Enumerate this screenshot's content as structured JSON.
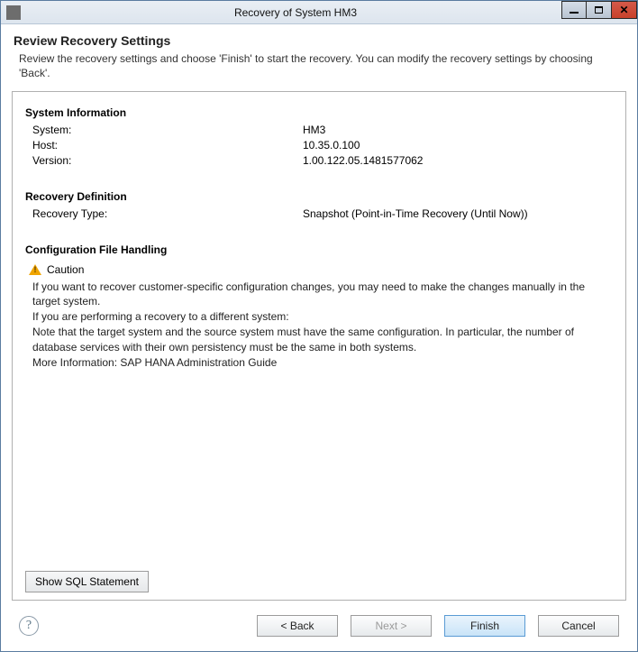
{
  "window": {
    "title": "Recovery of System HM3"
  },
  "header": {
    "title": "Review Recovery Settings",
    "description": "Review the recovery settings and choose 'Finish' to start the recovery. You can modify the recovery settings by choosing 'Back'."
  },
  "sections": {
    "system_info": {
      "title": "System Information",
      "rows": [
        {
          "label": "System:",
          "value": "HM3"
        },
        {
          "label": "Host:",
          "value": "10.35.0.100"
        },
        {
          "label": "Version:",
          "value": "1.00.122.05.1481577062"
        }
      ]
    },
    "recovery_def": {
      "title": "Recovery Definition",
      "rows": [
        {
          "label": "Recovery Type:",
          "value": "Snapshot (Point-in-Time Recovery (Until Now))"
        }
      ]
    },
    "config_handling": {
      "title": "Configuration File Handling",
      "caution_label": "Caution",
      "body_line1": "If you want to recover customer-specific configuration changes, you may need to make the changes manually in the target system.",
      "body_line2": "If you are performing a recovery to a different system:",
      "body_line3": "Note that the target system and the source system must have the same configuration. In particular, the number of database services with their own persistency must be the same in both systems.",
      "body_line4": "More Information: SAP HANA Administration Guide"
    }
  },
  "buttons": {
    "show_sql": "Show SQL Statement",
    "back": "< Back",
    "next": "Next >",
    "finish": "Finish",
    "cancel": "Cancel"
  }
}
